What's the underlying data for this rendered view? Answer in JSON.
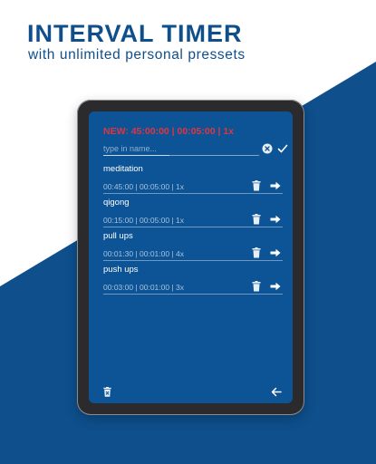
{
  "banner": {
    "title": "INTERVAL TIMER",
    "subtitle": "with unlimited personal pressets"
  },
  "colors": {
    "brand_blue": "#0e4f8c",
    "screen_blue": "#0d5496",
    "new_red": "#e0353f"
  },
  "editor": {
    "new_preset": "NEW: 45:00:00 | 00:05:00 | 1x",
    "name_placeholder": "type in name...",
    "icons": [
      "clear-circle-icon",
      "check-icon"
    ]
  },
  "presets": [
    {
      "name": "meditation",
      "values": "00:45:00 | 00:05:00 | 1x"
    },
    {
      "name": "qigong",
      "values": "00:15:00 | 00:05:00 | 1x"
    },
    {
      "name": "pull ups",
      "values": "00:01:30 | 00:01:00 | 4x"
    },
    {
      "name": "push ups",
      "values": "00:03:00 | 00:01:00 | 3x"
    }
  ],
  "preset_icons": [
    "trash-icon",
    "arrow-right-icon"
  ],
  "bottom_bar": {
    "icons": [
      "delete-all-icon",
      "back-arrow-icon"
    ]
  }
}
